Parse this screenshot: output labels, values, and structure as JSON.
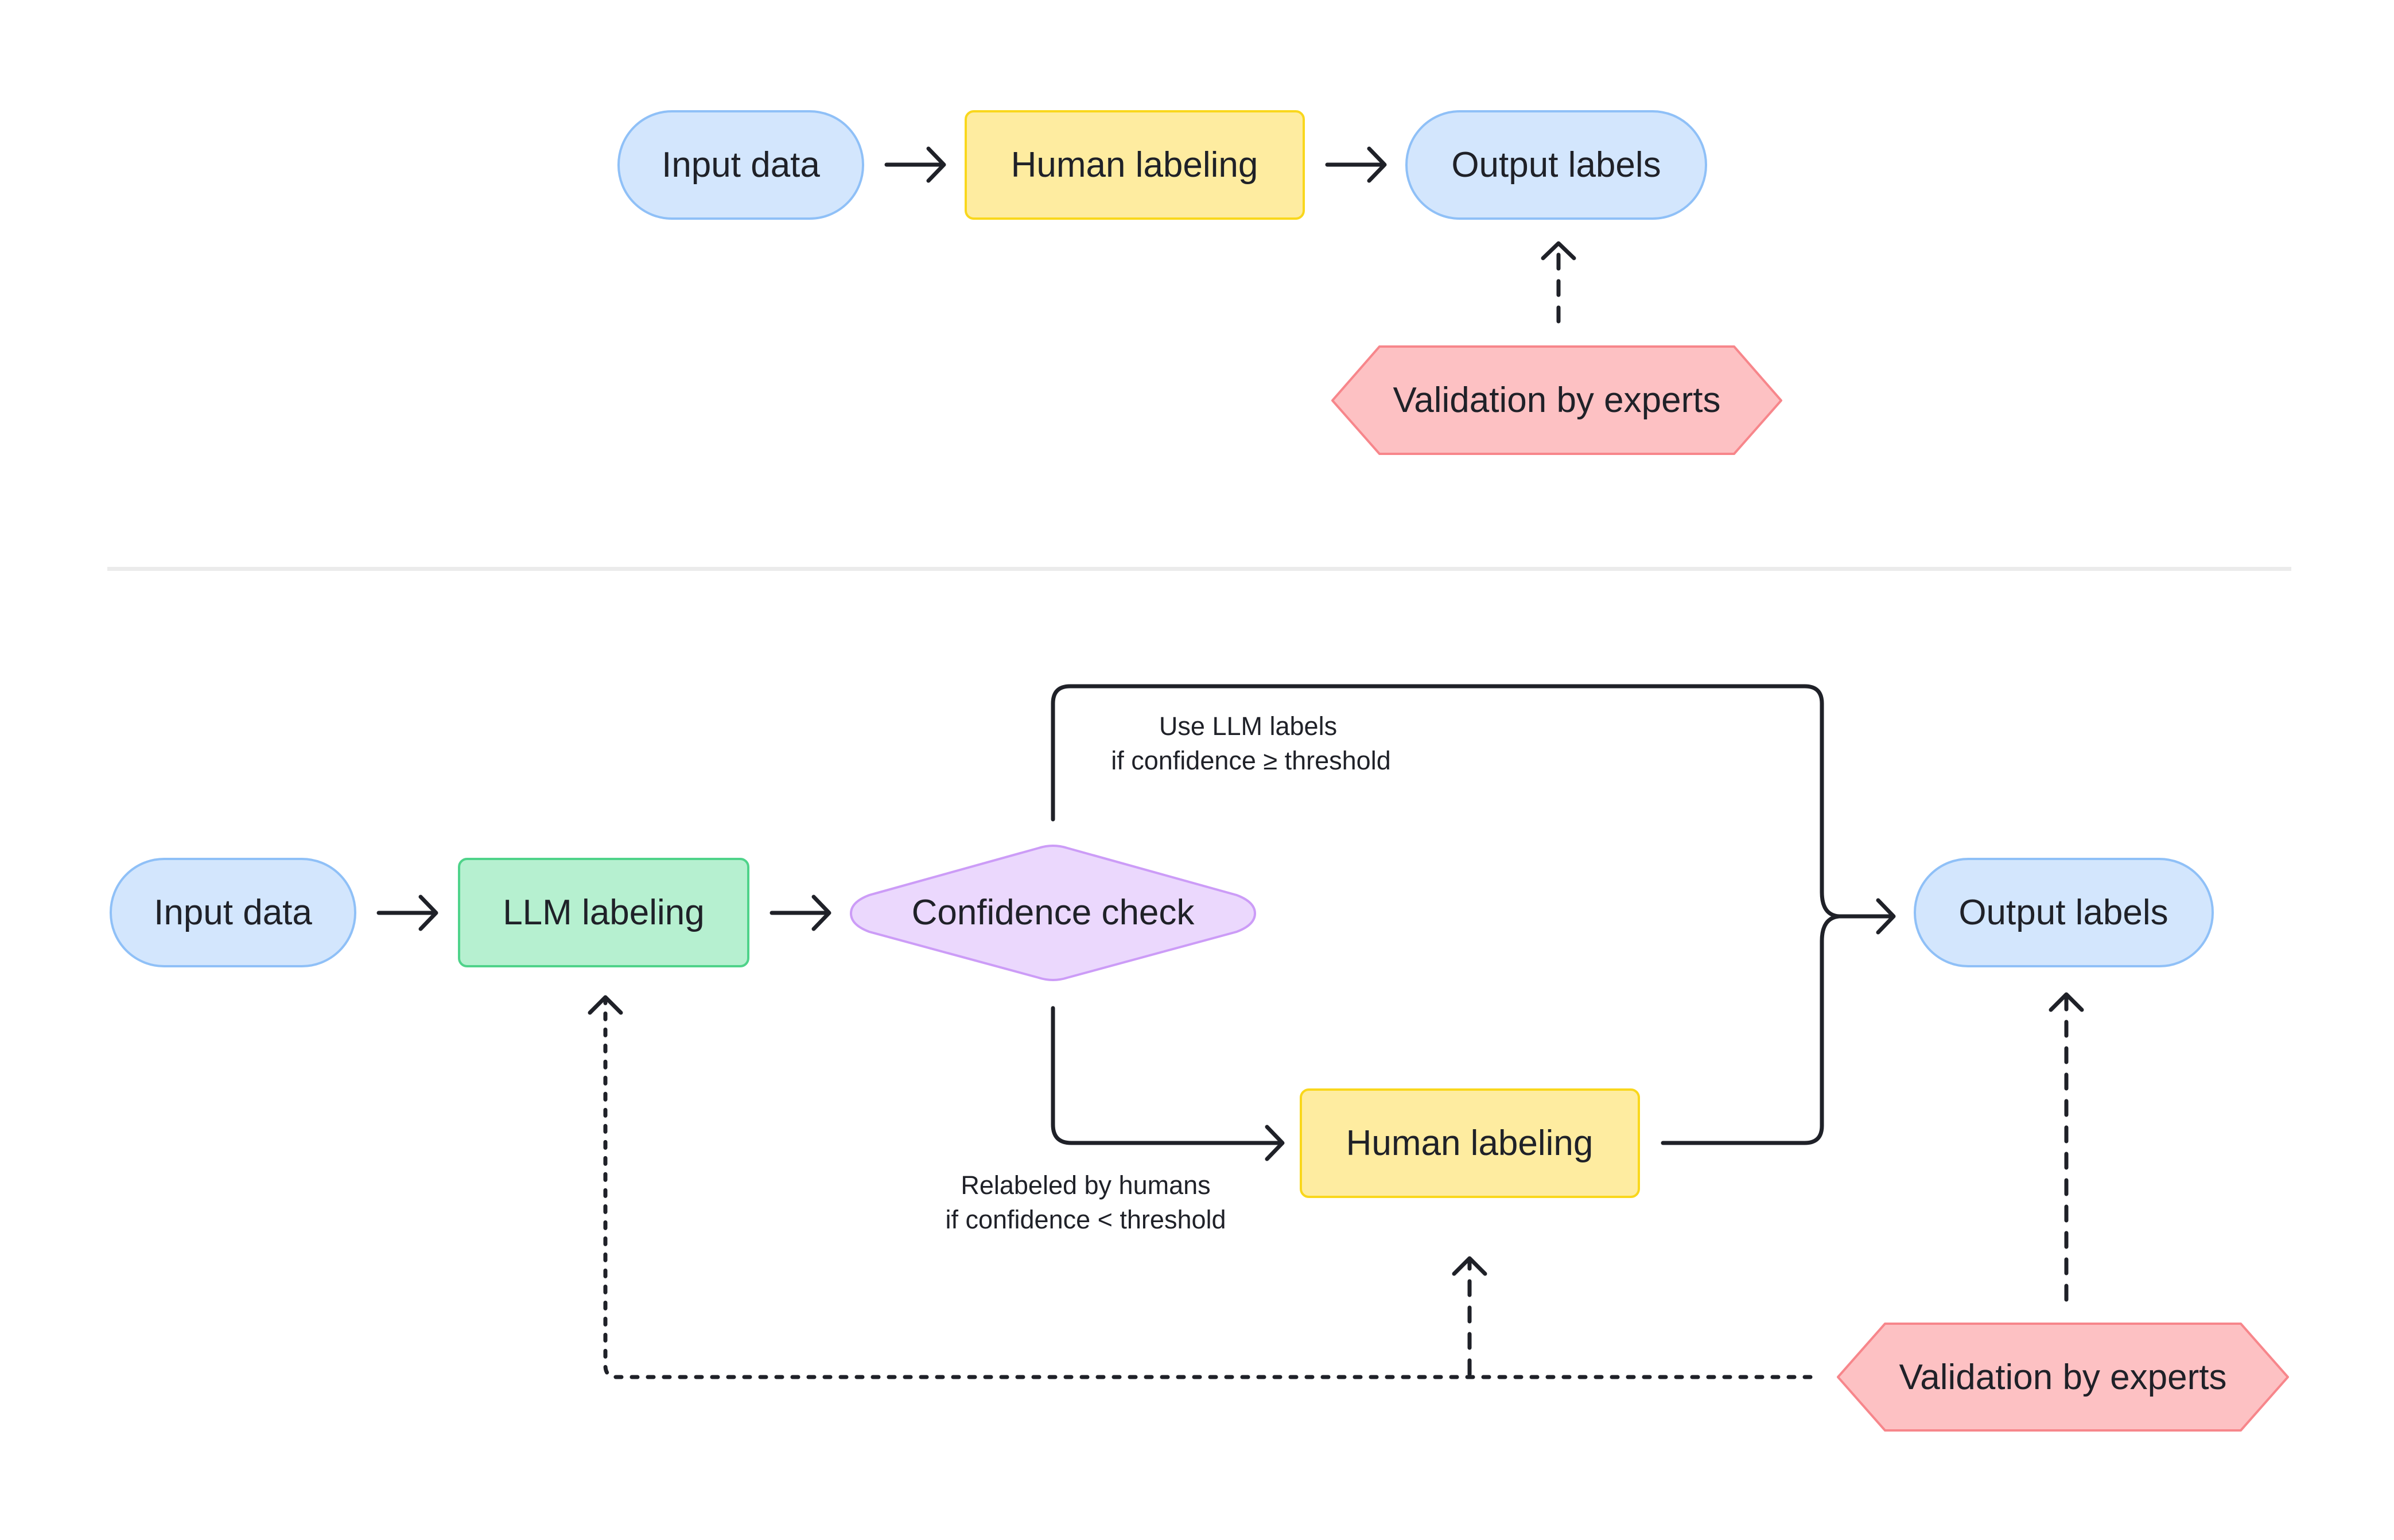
{
  "colors": {
    "terminal_fill": "#d3e6fd",
    "terminal_stroke": "#8fc0f7",
    "human_fill": "#feeca0",
    "human_stroke": "#f9d71c",
    "llm_fill": "#b6f0d0",
    "llm_stroke": "#4fd38a",
    "decision_fill": "#ebd8fd",
    "decision_stroke": "#cc9cf7",
    "validation_fill": "#fdc1c3",
    "validation_stroke": "#f7868b",
    "edge": "#1f2128",
    "divider": "#ebebeb"
  },
  "top_flow": {
    "input": "Input data",
    "process": "Human labeling",
    "output": "Output labels",
    "validation": "Validation by experts"
  },
  "bottom_flow": {
    "input": "Input data",
    "llm": "LLM labeling",
    "decision": "Confidence check",
    "human": "Human labeling",
    "output": "Output labels",
    "validation": "Validation by experts",
    "high_conf_label": [
      "Use LLM labels",
      "if confidence ≥ threshold"
    ],
    "low_conf_label": [
      "Relabeled by humans",
      "if confidence < threshold"
    ]
  }
}
